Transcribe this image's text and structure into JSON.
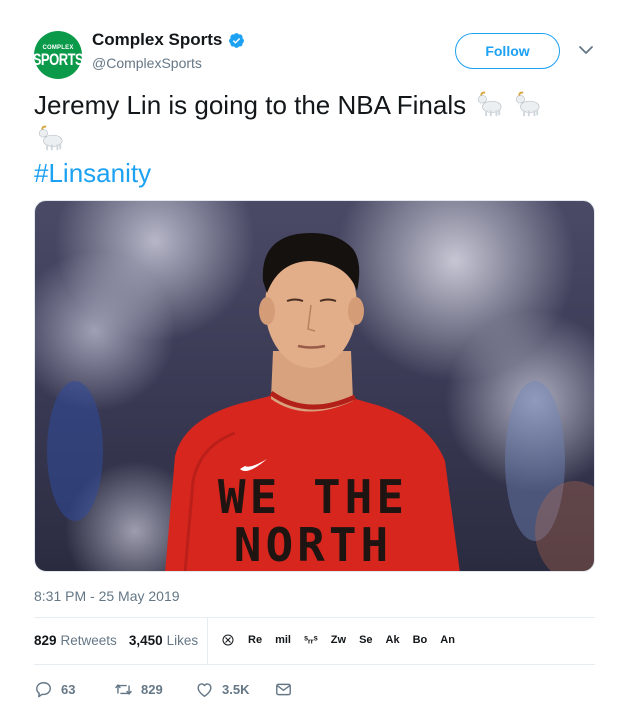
{
  "author": {
    "avatar_line1": "COMPLEX",
    "avatar_line2": "SPORTS",
    "display_name": "Complex Sports",
    "handle": "@ComplexSports",
    "verified": true,
    "brand_color": "#0b9a4a"
  },
  "follow_label": "Follow",
  "tweet": {
    "text": "Jeremy Lin is going to the NBA Finals",
    "emoji": [
      "goat-icon",
      "goat-icon",
      "goat-icon"
    ],
    "hashtag": "#Linsanity"
  },
  "photo": {
    "shirt_line1": "WE THE",
    "shirt_line2": "NORTH"
  },
  "timestamp": "8:31 PM - 25 May 2019",
  "stats": {
    "retweets_count": "829",
    "retweets_label": "Retweets",
    "likes_count": "3,450",
    "likes_label": "Likes"
  },
  "likers": [
    "Re",
    "mil",
    "ˢᵣᵣˢ",
    "Zw",
    "Se",
    "Ak",
    "Bo",
    "An"
  ],
  "actions": {
    "reply_count": "63",
    "retweet_count": "829",
    "like_count": "3.5K"
  },
  "colors": {
    "accent": "#1da1f2",
    "text": "#14171a",
    "muted": "#657786",
    "jersey": "#d7261e"
  }
}
